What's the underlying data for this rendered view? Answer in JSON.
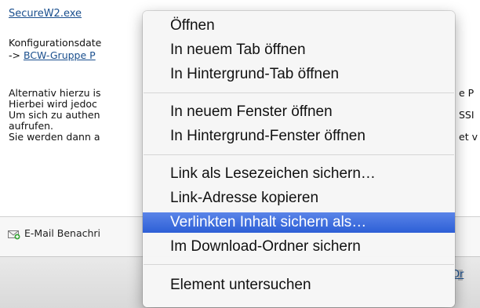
{
  "page": {
    "file_link": "SecureW2.exe",
    "config_line": "Konfigurationsdate",
    "config_link_prefix": "->",
    "config_link": "BCW-Gruppe P",
    "para_lines": [
      "Alternativ hierzu is",
      "Hierbei wird jedoc",
      "Um sich zu authen",
      "aufrufen.",
      "Sie werden dann a"
    ],
    "right_fragments": [
      "e P",
      "SSI",
      "et v"
    ],
    "email_notice": "E-Mail Benachri",
    "bottom_link": "Dr"
  },
  "context_menu": {
    "items": [
      {
        "label": "Öffnen",
        "selected": false
      },
      {
        "label": "In neuem Tab öffnen",
        "selected": false
      },
      {
        "label": "In Hintergrund-Tab öffnen",
        "selected": false
      },
      {
        "label": "In neuem Fenster öffnen",
        "selected": false
      },
      {
        "label": "In Hintergrund-Fenster öffnen",
        "selected": false
      },
      {
        "label": "Link als Lesezeichen sichern…",
        "selected": false
      },
      {
        "label": "Link-Adresse kopieren",
        "selected": false
      },
      {
        "label": "Verlinkten Inhalt sichern als…",
        "selected": true
      },
      {
        "label": "Im Download-Ordner sichern",
        "selected": false
      },
      {
        "label": "Element untersuchen",
        "selected": false
      }
    ]
  },
  "colors": {
    "link": "#1a4f8e",
    "menu_highlight": "#2d5fd6",
    "menu_background": "#f6f6f6"
  }
}
